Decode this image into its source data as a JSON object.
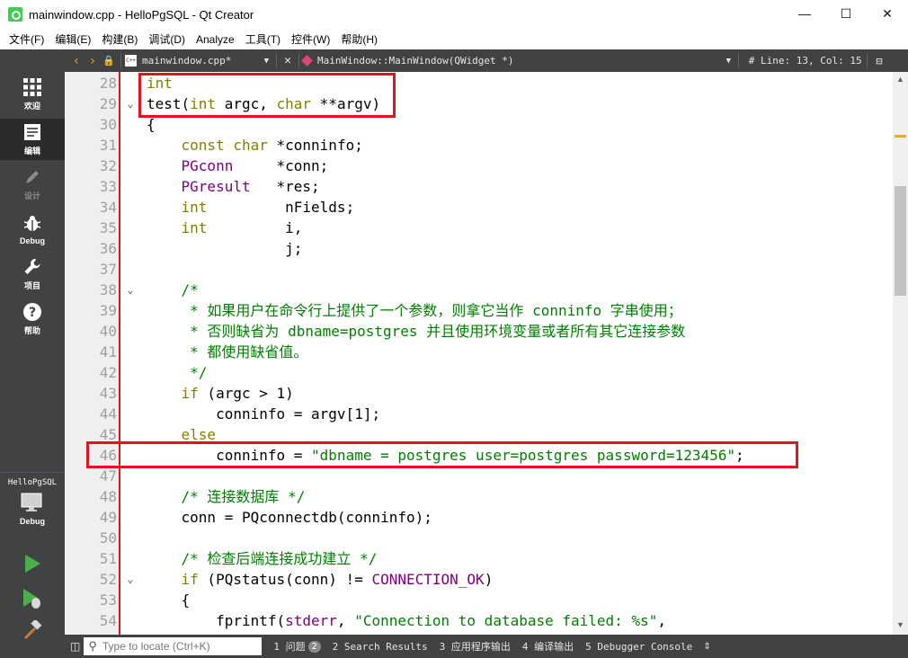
{
  "window": {
    "title": "mainwindow.cpp - HelloPgSQL - Qt Creator",
    "minimize": "—",
    "maximize": "☐",
    "close": "✕"
  },
  "menu": [
    "文件(F)",
    "编辑(E)",
    "构建(B)",
    "调试(D)",
    "Analyze",
    "工具(T)",
    "控件(W)",
    "帮助(H)"
  ],
  "modes": [
    {
      "label": "欢迎",
      "icon": "grid-icon"
    },
    {
      "label": "编辑",
      "icon": "document-icon"
    },
    {
      "label": "设计",
      "icon": "pencil-icon"
    },
    {
      "label": "Debug",
      "icon": "bug-icon"
    },
    {
      "label": "项目",
      "icon": "wrench-icon"
    },
    {
      "label": "帮助",
      "icon": "help-icon"
    }
  ],
  "project": {
    "name": "HelloPgSQL",
    "config": "Debug"
  },
  "toolbar": {
    "file": "mainwindow.cpp*",
    "symbol": "MainWindow::MainWindow(QWidget *)",
    "hash": "#",
    "position": "Line: 13, Col: 15"
  },
  "code_lines": [
    {
      "n": "28",
      "fold": "",
      "html": "<span class=\"kw\">int</span>"
    },
    {
      "n": "29",
      "fold": "⌄",
      "html": "test(<span class=\"kw\">int</span> argc, <span class=\"kw\">char</span> **argv)"
    },
    {
      "n": "30",
      "fold": "",
      "html": "{"
    },
    {
      "n": "31",
      "fold": "",
      "html": "    <span class=\"kw\">const</span> <span class=\"kw\">char</span> *conninfo;"
    },
    {
      "n": "32",
      "fold": "",
      "html": "    <span class=\"ty\">PGconn</span>     *conn;"
    },
    {
      "n": "33",
      "fold": "",
      "html": "    <span class=\"ty\">PGresult</span>   *res;"
    },
    {
      "n": "34",
      "fold": "",
      "html": "    <span class=\"kw\">int</span>         nFields;"
    },
    {
      "n": "35",
      "fold": "",
      "html": "    <span class=\"kw\">int</span>         i,"
    },
    {
      "n": "36",
      "fold": "",
      "html": "                j;"
    },
    {
      "n": "37",
      "fold": "",
      "html": ""
    },
    {
      "n": "38",
      "fold": "⌄",
      "html": "    <span class=\"cm\">/*</span>"
    },
    {
      "n": "39",
      "fold": "",
      "html": "<span class=\"cm\">     * 如果用户在命令行上提供了一个参数，则拿它当作 conninfo 字串使用；</span>"
    },
    {
      "n": "40",
      "fold": "",
      "html": "<span class=\"cm\">     * 否则缺省为 dbname=postgres 并且使用环境变量或者所有其它连接参数</span>"
    },
    {
      "n": "41",
      "fold": "",
      "html": "<span class=\"cm\">     * 都使用缺省值。</span>"
    },
    {
      "n": "42",
      "fold": "",
      "html": "<span class=\"cm\">     */</span>"
    },
    {
      "n": "43",
      "fold": "",
      "html": "    <span class=\"kw\">if</span> (argc &gt; 1)"
    },
    {
      "n": "44",
      "fold": "",
      "html": "        conninfo = argv[1];"
    },
    {
      "n": "45",
      "fold": "",
      "html": "    <span class=\"kw\">else</span>"
    },
    {
      "n": "46",
      "fold": "",
      "html": "        conninfo = <span class=\"st\">\"dbname = postgres user=postgres password=123456\"</span>;"
    },
    {
      "n": "47",
      "fold": "",
      "html": ""
    },
    {
      "n": "48",
      "fold": "",
      "html": "    <span class=\"cm\">/* 连接数据库 */</span>"
    },
    {
      "n": "49",
      "fold": "",
      "html": "    conn = PQconnectdb(conninfo);"
    },
    {
      "n": "50",
      "fold": "",
      "html": ""
    },
    {
      "n": "51",
      "fold": "",
      "html": "    <span class=\"cm\">/* 检查后端连接成功建立 */</span>"
    },
    {
      "n": "52",
      "fold": "⌄",
      "html": "    <span class=\"kw\">if</span> (PQstatus(conn) != <span class=\"cn\">CONNECTION_OK</span>)"
    },
    {
      "n": "53",
      "fold": "",
      "html": "    {"
    },
    {
      "n": "54",
      "fold": "",
      "html": "        fprintf(<span class=\"ty\">stderr</span>, <span class=\"st\">\"Connection to database failed: %s\"</span>,"
    }
  ],
  "statusbar": {
    "locate_placeholder": "Type to locate (Ctrl+K)",
    "panes": [
      {
        "label": "1 问题",
        "badge": "2"
      },
      {
        "label": "2 Search Results"
      },
      {
        "label": "3 应用程序输出"
      },
      {
        "label": "4 编译输出"
      },
      {
        "label": "5 Debugger Console"
      }
    ]
  }
}
